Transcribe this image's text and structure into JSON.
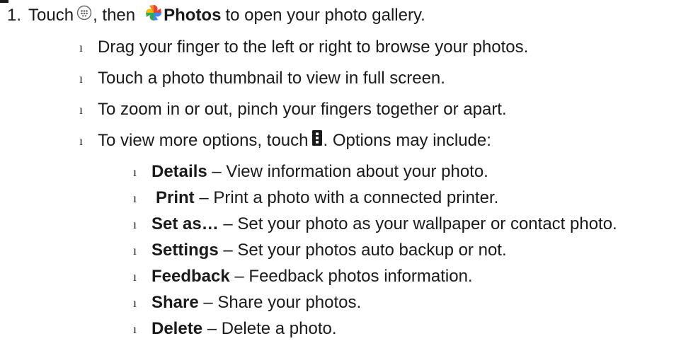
{
  "step": {
    "number": "1.",
    "part1": "Touch",
    "part2": ", then",
    "app_name": "Photos",
    "part3": "to open your photo gallery."
  },
  "icons": {
    "apps": "apps-circle-icon",
    "photos": "google-photos-pinwheel-icon",
    "menu": "vertical-dots-menu-icon"
  },
  "bullet_marker": "ı",
  "tips": [
    "Drag your finger to the left or right to browse your photos.",
    "Touch a photo thumbnail to view in full screen.",
    "To zoom in or out, pinch your fingers together or apart."
  ],
  "more_options": {
    "before": "To view more options, touch",
    "after": ". Options may include:"
  },
  "options": [
    {
      "term": "Details",
      "desc": "– View information about your photo."
    },
    {
      "term": "Print",
      "desc": "– Print a photo with a connected printer."
    },
    {
      "term": "Set as…",
      "desc": "– Set your photo as your wallpaper or contact photo."
    },
    {
      "term": "Settings",
      "desc": "– Set your photos auto backup or not."
    },
    {
      "term": "Feedback",
      "desc": "– Feedback photos information."
    },
    {
      "term": "Share",
      "desc": "– Share your photos."
    },
    {
      "term": "Delete",
      "desc": "– Delete a photo."
    }
  ],
  "colors": {
    "text": "#1a1a1a",
    "photos_red": "#e94235",
    "photos_yellow": "#fbbc04",
    "photos_green": "#34a853",
    "photos_blue": "#4285f4"
  }
}
